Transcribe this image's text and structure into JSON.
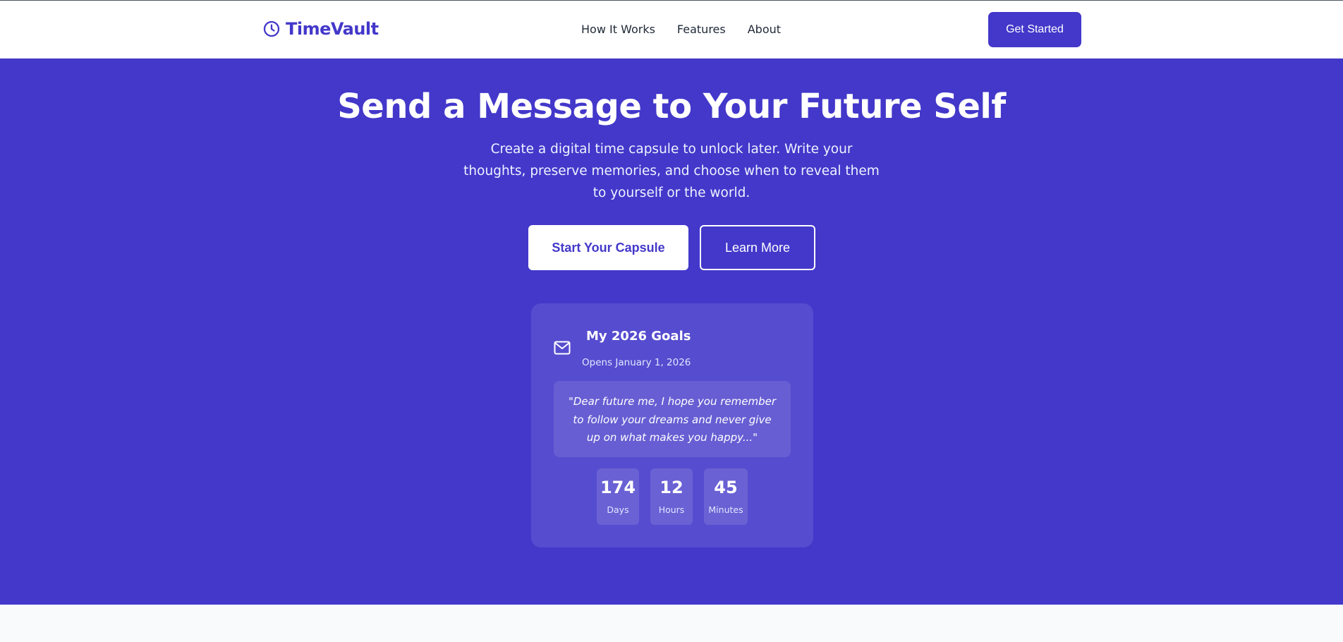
{
  "brand": {
    "name": "TimeVault",
    "icon": "clock-icon",
    "color": "#4338ca"
  },
  "nav": {
    "links": [
      {
        "label": "How It Works"
      },
      {
        "label": "Features"
      },
      {
        "label": "About"
      }
    ],
    "cta_label": "Get Started"
  },
  "hero": {
    "title": "Send a Message to Your Future Self",
    "subtitle": "Create a digital time capsule to unlock later. Write your thoughts, preserve memories, and choose when to reveal them to yourself or the world.",
    "primary_button": "Start Your Capsule",
    "secondary_button": "Learn More",
    "background": "#4338ca"
  },
  "capsule": {
    "icon": "mail-icon",
    "title": "My 2026 Goals",
    "opens": "Opens January 1, 2026",
    "quote": "\"Dear future me, I hope you remember to follow your dreams and never give up on what makes you happy...\"",
    "countdown": [
      {
        "value": "174",
        "label": "Days"
      },
      {
        "value": "12",
        "label": "Hours"
      },
      {
        "value": "45",
        "label": "Minutes"
      }
    ]
  }
}
